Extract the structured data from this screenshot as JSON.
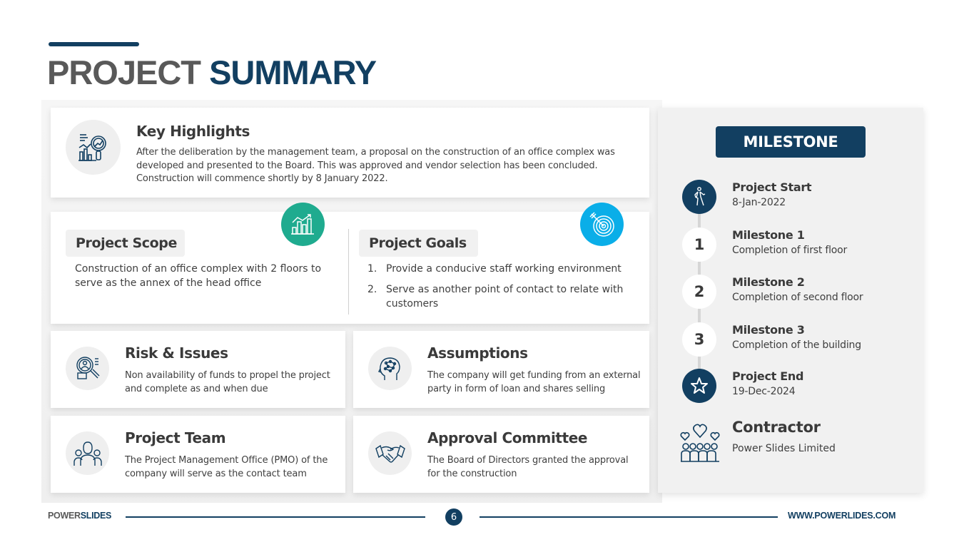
{
  "title": {
    "part1": "PROJECT",
    "part2": "SUMMARY"
  },
  "colors": {
    "primary": "#123f61",
    "accent_green": "#1fab8f",
    "accent_blue": "#0aaee8",
    "gray_text": "#595959"
  },
  "key_highlights": {
    "icon": "analytics-magnifier-icon",
    "heading": "Key Highlights",
    "text": "After the deliberation by the management team, a proposal on the construction of an office complex was developed and presented to the Board. This was approved and vendor selection has been concluded. Construction will commence shortly by 8 January 2022."
  },
  "scope": {
    "icon": "growth-chart-icon",
    "heading": "Project Scope",
    "text": "Construction of an office complex with 2 floors to serve as the annex of the head office"
  },
  "goals": {
    "icon": "target-icon",
    "heading": "Project Goals",
    "items": [
      {
        "num": "1.",
        "text": "Provide a conducive staff working environment"
      },
      {
        "num": "2.",
        "text": "Serve as another point of contact to relate with customers"
      }
    ]
  },
  "cards": [
    {
      "icon": "risk-search-icon",
      "heading": "Risk & Issues",
      "text": "Non availability of funds to propel the project and complete as and when due"
    },
    {
      "icon": "brain-head-icon",
      "heading": "Assumptions",
      "text": "The company will get funding from an external party in form of loan and shares selling"
    },
    {
      "icon": "team-icon",
      "heading": "Project Team",
      "text": "The Project Management Office (PMO) of the company will serve as the contact team"
    },
    {
      "icon": "handshake-icon",
      "heading": "Approval Committee",
      "text": "The Board of Directors granted the approval for the construction"
    }
  ],
  "milestone": {
    "header": "MILESTONE",
    "items": [
      {
        "node": "",
        "icon": "walking-person-icon",
        "title": "Project Start",
        "sub": "8-Jan-2022"
      },
      {
        "node": "1",
        "title": "Milestone 1",
        "sub": "Completion of first floor"
      },
      {
        "node": "2",
        "title": "Milestone 2",
        "sub": "Completion of second floor"
      },
      {
        "node": "3",
        "title": "Milestone 3",
        "sub": "Completion of the building"
      },
      {
        "node": "",
        "icon": "star-icon",
        "title": "Project End",
        "sub": "19-Dec-2024"
      }
    ],
    "contractor": {
      "icon": "community-hearts-icon",
      "title": "Contractor",
      "sub": "Power Slides Limited"
    }
  },
  "footer": {
    "brand1": "POWER",
    "brand2": "SLIDES",
    "page": "6",
    "url": "WWW.POWERLIDES.COM"
  }
}
